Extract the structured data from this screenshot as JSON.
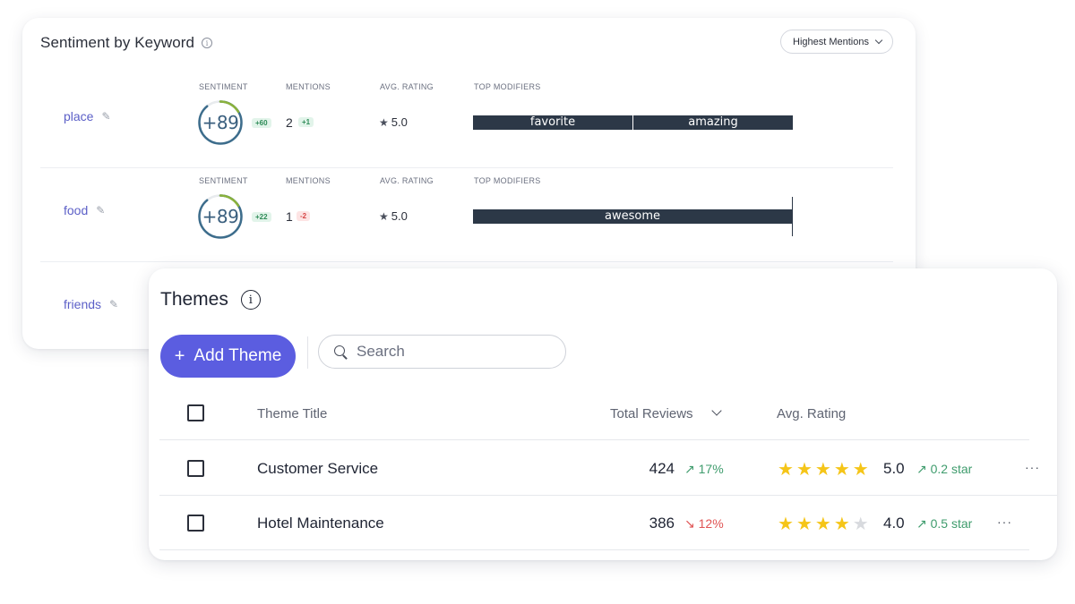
{
  "sentiment": {
    "title": "Sentiment by Keyword",
    "sort_label": "Highest Mentions",
    "columns": {
      "sentiment": "SENTIMENT",
      "mentions": "MENTIONS",
      "avg_rating": "AVG. RATING",
      "top_modifiers": "TOP MODIFIERS"
    },
    "rows": [
      {
        "keyword": "place",
        "score": "+89",
        "score_value": 89,
        "score_delta": "+60",
        "mentions": "2",
        "mentions_delta": "+1",
        "rating": "5.0",
        "modifiers": [
          "favorite",
          "amazing"
        ]
      },
      {
        "keyword": "food",
        "score": "+89",
        "score_value": 89,
        "score_delta": "+22",
        "mentions": "1",
        "mentions_delta": "-2",
        "rating": "5.0",
        "modifiers": [
          "awesome"
        ]
      },
      {
        "keyword": "friends"
      }
    ]
  },
  "themes": {
    "title": "Themes",
    "add_label": "Add Theme",
    "search_placeholder": "Search",
    "headers": {
      "title": "Theme Title",
      "total_reviews": "Total Reviews",
      "avg_rating": "Avg. Rating"
    },
    "rows": [
      {
        "title": "Customer Service",
        "reviews": "424",
        "reviews_trend": "17%",
        "reviews_trend_dir": "up",
        "stars": 5,
        "avg": "5.0",
        "avg_trend": "0.2 star",
        "avg_trend_dir": "up"
      },
      {
        "title": "Hotel Maintenance",
        "reviews": "386",
        "reviews_trend": "12%",
        "reviews_trend_dir": "down",
        "stars": 4,
        "avg": "4.0",
        "avg_trend": "0.5 star",
        "avg_trend_dir": "up"
      }
    ]
  },
  "colors": {
    "accent": "#5b5de0",
    "keyword": "#5b5fc7",
    "positive": "#3f9c6d",
    "negative": "#e05555",
    "star": "#f5c518",
    "modifier_bar": "#2c3847"
  },
  "icons": [
    "info-icon",
    "chevron-down-icon",
    "pencil-icon",
    "star-icon",
    "plus-icon",
    "search-icon",
    "trend-up-icon",
    "trend-down-icon",
    "more-icon"
  ]
}
